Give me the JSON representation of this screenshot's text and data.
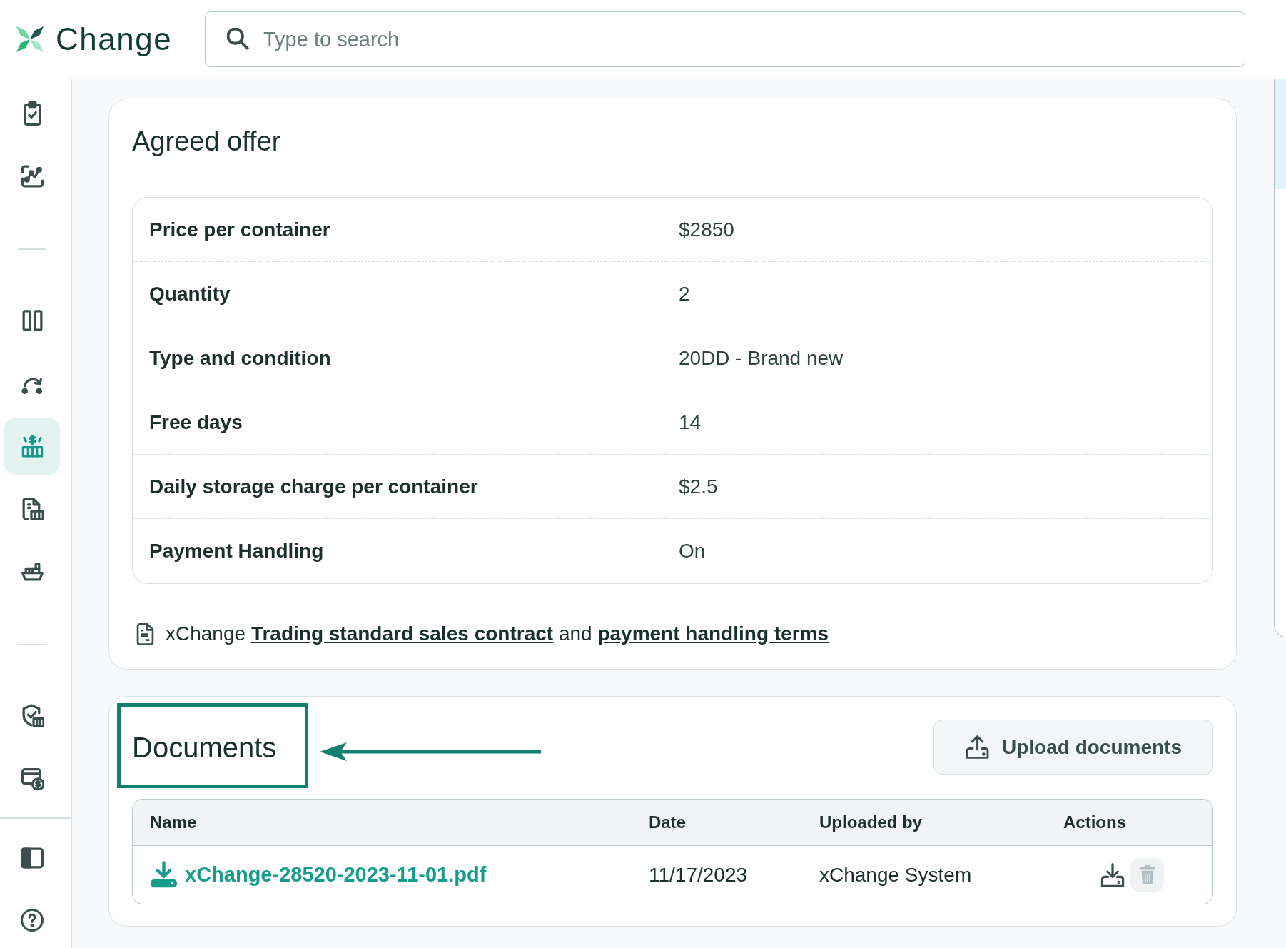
{
  "header": {
    "logo_text": "Change",
    "search": {
      "placeholder": "Type to search"
    }
  },
  "sidebar": {
    "groups": [
      {
        "items": [
          {
            "selected": false
          },
          {
            "selected": false
          }
        ]
      },
      {
        "items": [
          {
            "selected": false
          },
          {
            "selected": false
          },
          {
            "selected": true
          },
          {
            "selected": false
          },
          {
            "selected": false
          }
        ]
      },
      {
        "items": [
          {
            "selected": false
          },
          {
            "selected": false
          }
        ]
      }
    ]
  },
  "agreed_offer": {
    "title": "Agreed offer",
    "rows": [
      {
        "label": "Price per container",
        "value": "$2850"
      },
      {
        "label": "Quantity",
        "value": "2"
      },
      {
        "label": "Type and condition",
        "value": "20DD - Brand new"
      },
      {
        "label": "Free days",
        "value": "14"
      },
      {
        "label": "Daily storage charge per container",
        "value": "$2.5"
      },
      {
        "label": "Payment Handling",
        "value": "On"
      }
    ],
    "contract_note": {
      "segments": [
        {
          "kind": "text",
          "text": "xChange"
        },
        {
          "kind": "link",
          "text": "Trading standard sales contract"
        },
        {
          "kind": "text",
          "text": "and"
        },
        {
          "kind": "link",
          "text": "payment handling terms"
        }
      ]
    }
  },
  "documents": {
    "title": "Documents",
    "highlighted": true,
    "upload_button": "Upload documents",
    "table": {
      "columns": [
        "Name",
        "Date",
        "Uploaded by",
        "Actions"
      ],
      "rows": [
        {
          "name": "xChange-28520-2023-11-01.pdf",
          "date": "11/17/2023",
          "uploaded_by": "xChange System",
          "delete_disabled": true
        }
      ]
    }
  }
}
